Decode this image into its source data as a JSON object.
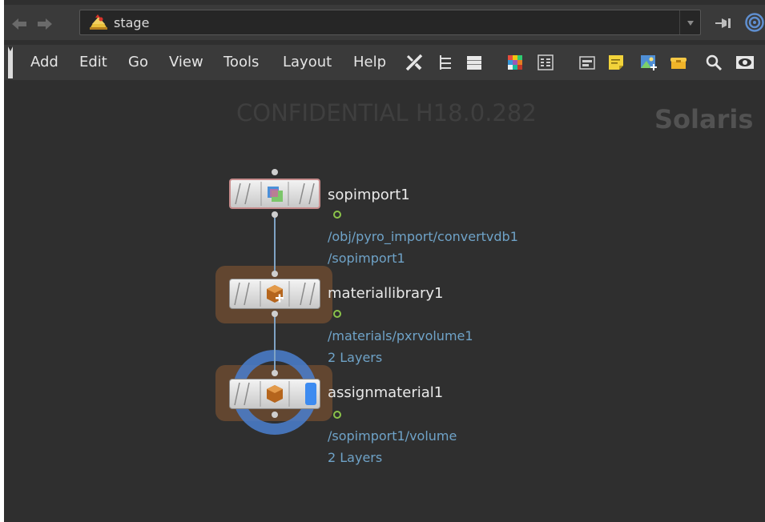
{
  "pathbar": {
    "path": "stage",
    "icons": [
      "back-arrow-icon",
      "forward-arrow-icon",
      "stage-icon",
      "dropdown-icon",
      "pin-icon",
      "network-target-icon"
    ]
  },
  "menubar": {
    "items": [
      "Add",
      "Edit",
      "Go",
      "View",
      "Tools",
      "Layout",
      "Help"
    ],
    "toolbar_icons": [
      "wrench-tools-icon",
      "tree-view-icon",
      "list-view-icon",
      "color-palette-icon",
      "grid-view-icon",
      "node-shape-icon",
      "sticky-note-icon",
      "background-image-icon",
      "network-box-icon",
      "search-icon",
      "eye-icon"
    ]
  },
  "network": {
    "watermark": "CONFIDENTIAL H18.0.282",
    "context": "Solaris",
    "nodes": [
      {
        "name": "sopimport1",
        "info": [
          "/obj/pyro_import/convertvdb1",
          "/sopimport1"
        ],
        "icon": "sop-import-icon"
      },
      {
        "name": "materiallibrary1",
        "info": [
          "/materials/pxrvolume1",
          "2 Layers"
        ],
        "icon": "material-library-icon"
      },
      {
        "name": "assignmaterial1",
        "info": [
          "/sopimport1/volume",
          "2 Layers"
        ],
        "icon": "assign-material-icon"
      }
    ]
  },
  "colors": {
    "background": "#2f2f2f",
    "bar": "#3a3a3a",
    "info_text": "#6fa3c8",
    "node_halo": "#6b4a30",
    "display_ring": "#4a7fcf",
    "wire": "#7fa3c4"
  }
}
